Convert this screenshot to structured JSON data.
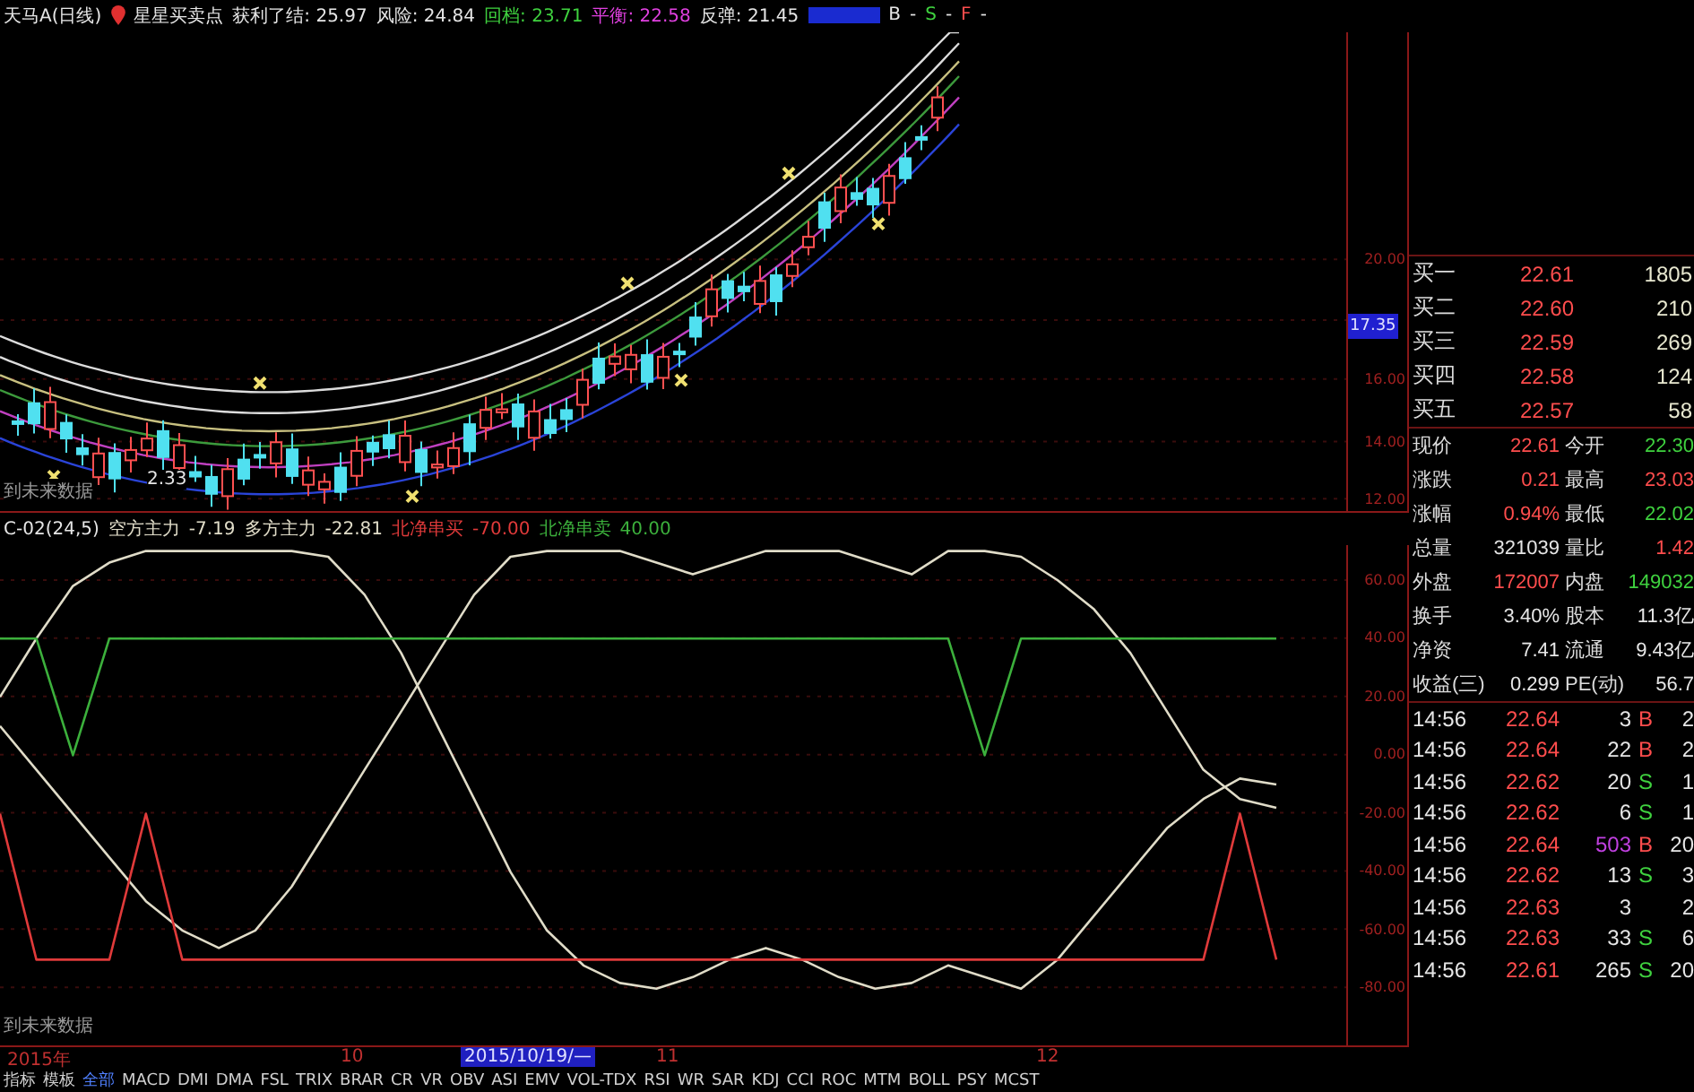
{
  "header": {
    "title": "天马A(日线)",
    "indicator": "星星买卖点",
    "items": [
      {
        "text": "获利了结: 25.97",
        "color": "#e6e6e6"
      },
      {
        "text": "风险: 24.84",
        "color": "#e6e6e6"
      },
      {
        "text": "回档: 23.71",
        "color": "#3fd23f"
      },
      {
        "text": "平衡: 22.58",
        "color": "#e040e0"
      },
      {
        "text": "反弹: 21.45",
        "color": "#e6e6e6"
      }
    ],
    "signals": [
      {
        "text": "B",
        "color": "#e6e6e6"
      },
      {
        "text": "-",
        "color": "#e6e6e6"
      },
      {
        "text": "S",
        "color": "#3fd23f"
      },
      {
        "text": "-",
        "color": "#e6e6e6"
      },
      {
        "text": "F",
        "color": "#ff4d4d"
      },
      {
        "text": "-",
        "color": "#e6e6e6"
      }
    ]
  },
  "main_chart": {
    "low_label": "2.33",
    "note": "到未来数据",
    "y_axis": [
      {
        "text": "20.00",
        "kind": "tick"
      },
      {
        "text": "17.35",
        "kind": "cursor"
      },
      {
        "text": "16.00",
        "kind": "tick"
      },
      {
        "text": "14.00",
        "kind": "tick"
      },
      {
        "text": "12.00",
        "kind": "tick"
      }
    ]
  },
  "sub_chart": {
    "title": "C-02(24,5)",
    "readings": [
      "-7.19",
      "-22.81",
      "-70.00",
      "40.00"
    ],
    "note": "到未来数据",
    "chart_data": {
      "type": "line",
      "grid": true,
      "ylim": [
        -100,
        72
      ],
      "yticks": [
        {
          "value": 60,
          "label": "60.00"
        },
        {
          "value": 40,
          "label": "40.00"
        },
        {
          "value": 20,
          "label": "20.00"
        },
        {
          "value": 0,
          "label": "0.00"
        },
        {
          "value": -20,
          "label": "-20.00"
        },
        {
          "value": -40,
          "label": "-40.00"
        },
        {
          "value": -60,
          "label": "-60.00"
        },
        {
          "value": -80,
          "label": "-80.00"
        }
      ],
      "series": [
        {
          "name": "空方主力",
          "color": "#e0dcc8",
          "values": [
            20,
            40,
            58,
            66,
            70,
            70,
            70,
            70,
            70,
            68,
            55,
            35,
            10,
            -15,
            -40,
            -60,
            -72,
            -78,
            -80,
            -76,
            -70,
            -66,
            -70,
            -76,
            -80,
            -78,
            -72,
            -76,
            -80,
            -70,
            -55,
            -40,
            -25,
            -15,
            -8,
            -10
          ]
        },
        {
          "name": "多方主力",
          "color": "#e0dcc8",
          "values": [
            10,
            -5,
            -20,
            -35,
            -50,
            -60,
            -66,
            -60,
            -45,
            -25,
            -5,
            15,
            35,
            55,
            68,
            70,
            70,
            70,
            66,
            62,
            66,
            70,
            70,
            70,
            66,
            62,
            70,
            70,
            68,
            60,
            50,
            35,
            15,
            -5,
            -15,
            -18
          ]
        },
        {
          "name": "北净串买",
          "color": "#e03a3a",
          "values": [
            -20,
            -70,
            -70,
            -70,
            -20,
            -70,
            -70,
            -70,
            -70,
            -70,
            -70,
            -70,
            -70,
            -70,
            -70,
            -70,
            -70,
            -70,
            -70,
            -70,
            -70,
            -70,
            -70,
            -70,
            -70,
            -70,
            -70,
            -70,
            -70,
            -70,
            -70,
            -70,
            -70,
            -70,
            -20,
            -70
          ]
        },
        {
          "name": "北净串卖",
          "color": "#3cb03c",
          "values": [
            40,
            40,
            0,
            40,
            40,
            40,
            40,
            40,
            40,
            40,
            40,
            40,
            40,
            40,
            40,
            40,
            40,
            40,
            40,
            40,
            40,
            40,
            40,
            40,
            40,
            40,
            40,
            0,
            40,
            40,
            40,
            40,
            40,
            40,
            40,
            40
          ]
        }
      ]
    }
  },
  "date_axis": [
    {
      "text": "2015年",
      "kind": "tick"
    },
    {
      "text": "10",
      "kind": "tick"
    },
    {
      "text": "2015/10/19/—",
      "kind": "cursor"
    },
    {
      "text": "11",
      "kind": "tick"
    },
    {
      "text": "12",
      "kind": "tick"
    }
  ],
  "tabs": [
    {
      "label": "指标",
      "selected": false
    },
    {
      "label": "模板",
      "selected": false
    },
    {
      "label": "全部",
      "selected": true
    },
    {
      "label": "MACD",
      "selected": false
    },
    {
      "label": "DMI",
      "selected": false
    },
    {
      "label": "DMA",
      "selected": false
    },
    {
      "label": "FSL",
      "selected": false
    },
    {
      "label": "TRIX",
      "selected": false
    },
    {
      "label": "BRAR",
      "selected": false
    },
    {
      "label": "CR",
      "selected": false
    },
    {
      "label": "VR",
      "selected": false
    },
    {
      "label": "OBV",
      "selected": false
    },
    {
      "label": "ASI",
      "selected": false
    },
    {
      "label": "EMV",
      "selected": false
    },
    {
      "label": "VOL-TDX",
      "selected": false
    },
    {
      "label": "RSI",
      "selected": false
    },
    {
      "label": "WR",
      "selected": false
    },
    {
      "label": "SAR",
      "selected": false
    },
    {
      "label": "KDJ",
      "selected": false
    },
    {
      "label": "CCI",
      "selected": false
    },
    {
      "label": "ROC",
      "selected": false
    },
    {
      "label": "MTM",
      "selected": false
    },
    {
      "label": "BOLL",
      "selected": false
    },
    {
      "label": "PSY",
      "selected": false
    },
    {
      "label": "MCST",
      "selected": false
    }
  ],
  "order_book": [
    {
      "label": "买一",
      "price": "22.61",
      "volume": "1805"
    },
    {
      "label": "买二",
      "price": "22.60",
      "volume": "210"
    },
    {
      "label": "买三",
      "price": "22.59",
      "volume": "269"
    },
    {
      "label": "买四",
      "price": "22.58",
      "volume": "124"
    },
    {
      "label": "买五",
      "price": "22.57",
      "volume": "58"
    }
  ],
  "quotes": [
    {
      "cells": [
        {
          "label": "现价",
          "value": "22.61",
          "color": "#ff4d4d"
        },
        {
          "label": "今开",
          "value": "22.30",
          "color": "#3fd23f"
        }
      ]
    },
    {
      "cells": [
        {
          "label": "涨跌",
          "value": "0.21",
          "color": "#ff4d4d"
        },
        {
          "label": "最高",
          "value": "23.03",
          "color": "#ff4d4d"
        }
      ]
    },
    {
      "cells": [
        {
          "label": "涨幅",
          "value": "0.94%",
          "color": "#ff4d4d"
        },
        {
          "label": "最低",
          "value": "22.02",
          "color": "#3fd23f"
        }
      ]
    },
    {
      "cells": [
        {
          "label": "总量",
          "value": "321039",
          "color": "#e6e6e6"
        },
        {
          "label": "量比",
          "value": "1.42",
          "color": "#ff4d4d"
        }
      ]
    },
    {
      "cells": [
        {
          "label": "外盘",
          "value": "172007",
          "color": "#ff4d4d"
        },
        {
          "label": "内盘",
          "value": "149032",
          "color": "#3fd23f"
        }
      ]
    },
    {
      "cells": [
        {
          "label": "换手",
          "value": "3.40%",
          "color": "#e6e6e6"
        },
        {
          "label": "股本",
          "value": "11.3亿",
          "color": "#e6e6e6"
        }
      ]
    },
    {
      "cells": [
        {
          "label": "净资",
          "value": "7.41",
          "color": "#e6e6e6"
        },
        {
          "label": "流通",
          "value": "9.43亿",
          "color": "#e6e6e6"
        }
      ]
    },
    {
      "cells": [
        {
          "label": "收益(三)",
          "value": "0.299",
          "color": "#e6e6e6"
        },
        {
          "label": "PE(动)",
          "value": "56.7",
          "color": "#e6e6e6"
        }
      ]
    }
  ],
  "ticks": [
    {
      "time": "14:56",
      "price": "22.64",
      "volume": "3",
      "large": false,
      "flag": "B",
      "color": "#ff4d4d",
      "count": "2"
    },
    {
      "time": "14:56",
      "price": "22.64",
      "volume": "22",
      "large": false,
      "flag": "B",
      "color": "#ff4d4d",
      "count": "2"
    },
    {
      "time": "14:56",
      "price": "22.62",
      "volume": "20",
      "large": false,
      "flag": "S",
      "color": "#3fd23f",
      "count": "1"
    },
    {
      "time": "14:56",
      "price": "22.62",
      "volume": "6",
      "large": false,
      "flag": "S",
      "color": "#3fd23f",
      "count": "1"
    },
    {
      "time": "14:56",
      "price": "22.64",
      "volume": "503",
      "large": true,
      "flag": "B",
      "color": "#ff4d4d",
      "count": "20"
    },
    {
      "time": "14:56",
      "price": "22.62",
      "volume": "13",
      "large": false,
      "flag": "S",
      "color": "#3fd23f",
      "count": "3"
    },
    {
      "time": "14:56",
      "price": "22.63",
      "volume": "3",
      "large": false,
      "count": "2"
    },
    {
      "time": "14:56",
      "price": "22.63",
      "volume": "33",
      "large": false,
      "flag": "S",
      "color": "#3fd23f",
      "count": "6"
    },
    {
      "time": "14:56",
      "price": "22.61",
      "volume": "265",
      "large": false,
      "flag": "S",
      "color": "#3fd23f",
      "count": "20"
    }
  ]
}
